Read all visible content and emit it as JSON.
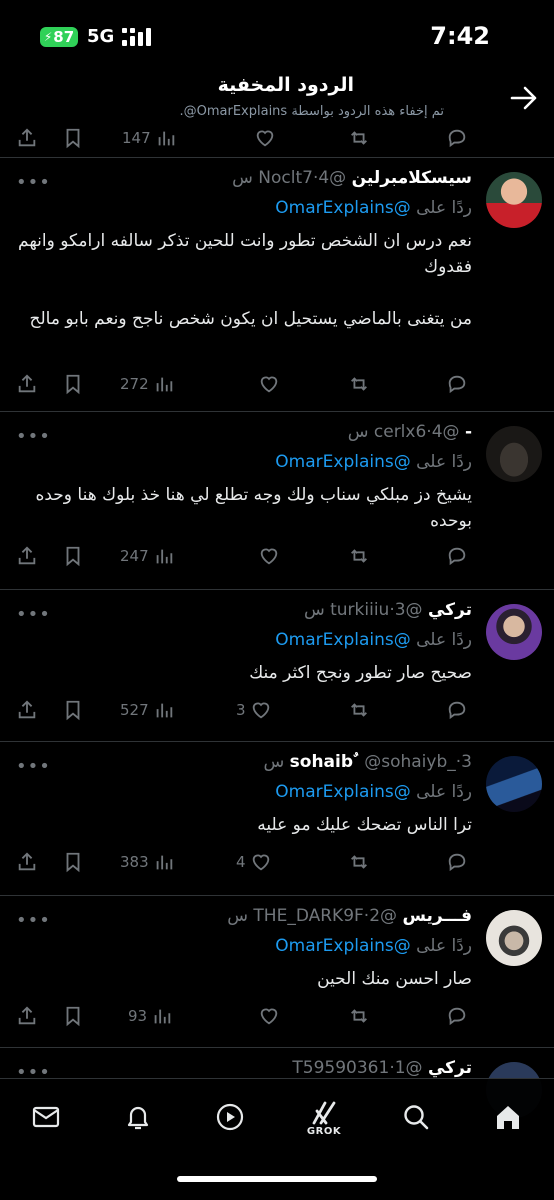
{
  "status_bar": {
    "battery": "87",
    "network": "5G",
    "time": "7:42"
  },
  "header": {
    "title": "الردود المخفية",
    "subtitle": "تم إخفاء هذه الردود بواسطة OmarExplains@."
  },
  "partial_tweet": {
    "views": "147"
  },
  "reply_to_label": "ردًا على",
  "tweets": [
    {
      "name": "سيسكلامبرلين",
      "handle": "@Noclt7",
      "time": "4 س",
      "mention": "@OmarExplains",
      "text": "نعم درس ان الشخص تطور وانت للحين تذكر سالفه ارامكو وانهم فقدوك\n\nمن يتغنى بالماضي يستحيل ان يكون شخص ناجح ونعم بابو مالح",
      "views": "272",
      "likes": ""
    },
    {
      "name": "-",
      "handle": "@cerlx6",
      "time": "4 س",
      "mention": "@OmarExplains",
      "text": "يشيخ دز مبلكي سناب ولك وجه تطلع لي هنا خذ بلوك هنا وحده بوحده",
      "views": "247",
      "likes": ""
    },
    {
      "name": "تركي",
      "handle": "@turkiiiu",
      "time": "3 س",
      "mention": "@OmarExplains",
      "text": "صحيح صار تطور ونجح اكثر منك",
      "views": "527",
      "likes": "3"
    },
    {
      "name": "sohaib ٌ",
      "handle": "@sohaiyb_",
      "time": "3 س",
      "mention": "@OmarExplains",
      "text": "ترا الناس تضحك عليك مو عليه",
      "views": "383",
      "likes": "4"
    },
    {
      "name": "فـــريس",
      "handle": "@THE_DARK9F",
      "time": "2 س",
      "mention": "@OmarExplains",
      "text": "صار احسن منك الحين",
      "views": "93",
      "likes": ""
    }
  ],
  "partial_bottom": {
    "name": "تركي",
    "handle": "@T59590361",
    "time": "1"
  },
  "tabbar": {
    "grok_label": "GROK"
  },
  "colors": {
    "accent": "#1d9bf0",
    "muted": "#71767b",
    "background": "#000000",
    "divider": "#2f3336"
  }
}
